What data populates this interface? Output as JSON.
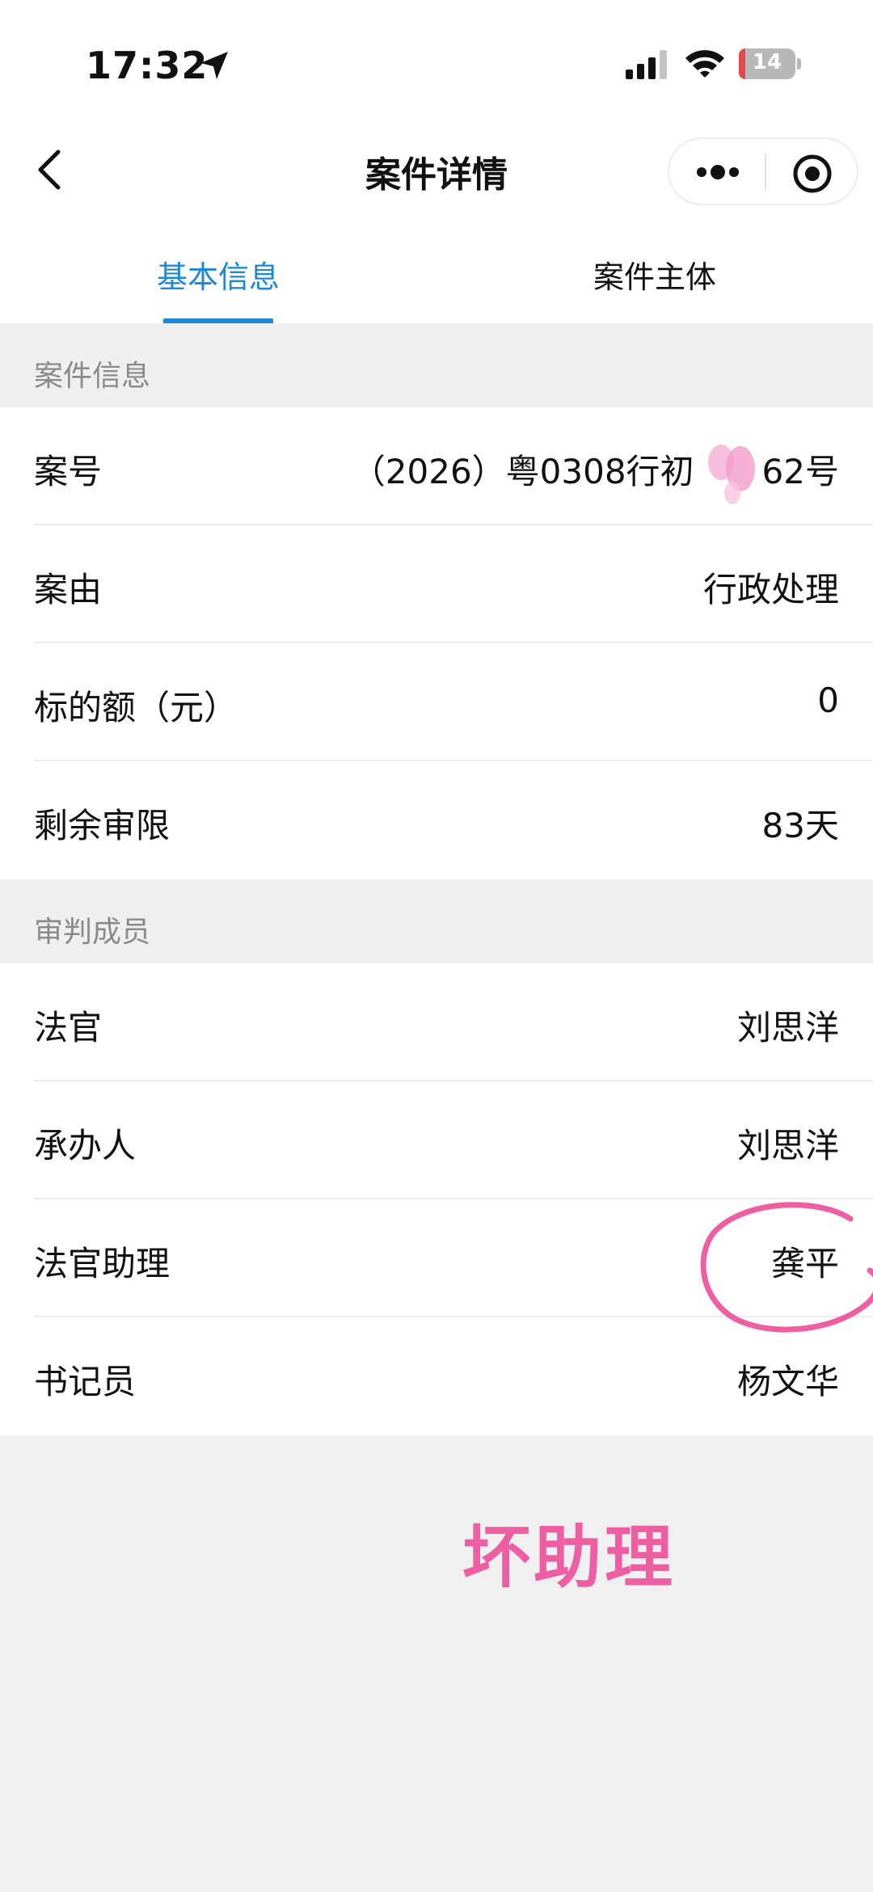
{
  "status_bar": {
    "time": "17:32",
    "battery_level": "14",
    "icons": [
      "location-arrow-icon",
      "cellular-signal-icon",
      "wifi-icon",
      "battery-icon"
    ]
  },
  "nav": {
    "title": "案件详情",
    "icons": [
      "back-chevron-icon",
      "more-dots-icon",
      "target-icon"
    ]
  },
  "tabs": [
    {
      "label": "基本信息",
      "active": true
    },
    {
      "label": "案件主体",
      "active": false
    }
  ],
  "case_info": {
    "section_title": "案件信息",
    "rows": [
      {
        "label": "案号",
        "value": "（2026）粤0308行初　　62号"
      },
      {
        "label": "案由",
        "value": "行政处理"
      },
      {
        "label": "标的额（元）",
        "value": "0"
      },
      {
        "label": "剩余审限",
        "value": "83天"
      }
    ]
  },
  "trial_members": {
    "section_title": "审判成员",
    "rows": [
      {
        "label": "法官",
        "value": "刘思洋"
      },
      {
        "label": "承办人",
        "value": "刘思洋"
      },
      {
        "label": "法官助理",
        "value": "龚平"
      },
      {
        "label": "书记员",
        "value": "杨文华"
      }
    ]
  },
  "annotation": {
    "text": "坏助理",
    "color": "#ee5ea2"
  },
  "colors": {
    "accent": "#1e88d8",
    "background": "#f0f0f0"
  }
}
